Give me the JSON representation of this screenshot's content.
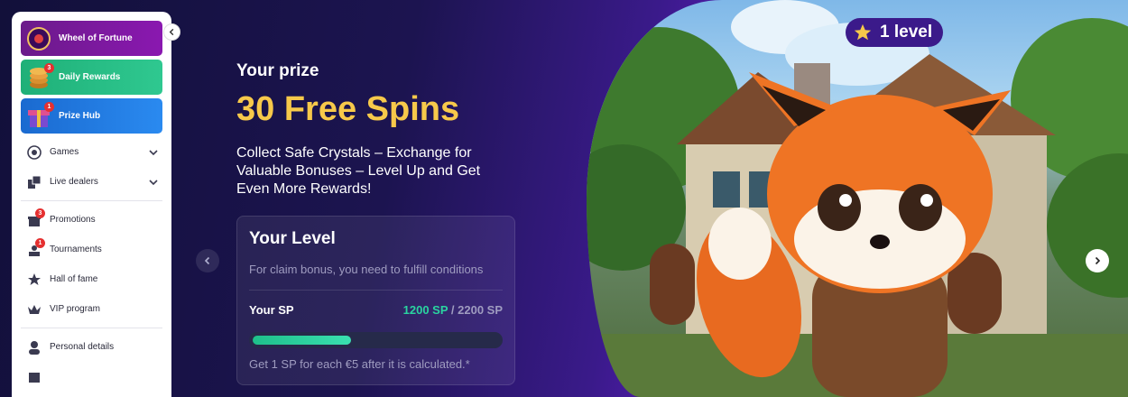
{
  "sidebar": {
    "promos": [
      {
        "label": "Wheel of Fortune",
        "badge": null
      },
      {
        "label": "Daily Rewards",
        "badge": "3"
      },
      {
        "label": "Prize Hub",
        "badge": "1"
      }
    ],
    "nav": [
      {
        "label": "Games"
      },
      {
        "label": "Live dealers"
      }
    ],
    "links": [
      {
        "label": "Promotions",
        "badge": "3"
      },
      {
        "label": "Tournaments",
        "badge": "1"
      },
      {
        "label": "Hall of fame"
      },
      {
        "label": "VIP program"
      }
    ],
    "account": [
      {
        "label": "Personal details"
      }
    ]
  },
  "hero": {
    "prize_label": "Your prize",
    "prize_value": "30 Free Spins",
    "description": "Collect Safe Crystals – Exchange for Valuable Bonuses – Level Up and Get Even More Rewards!",
    "level_badge": "1 level"
  },
  "level_card": {
    "title": "Your Level",
    "hint": "For claim bonus, you need to fulfill conditions",
    "sp_label": "Your SP",
    "sp_current": "1200 SP",
    "sp_separator": " / ",
    "sp_target": "2200 SP",
    "progress": 0.4,
    "note": "Get 1 SP for each €5 after it is calculated.*"
  },
  "colors": {
    "accent_gold": "#f7c94a",
    "accent_green": "#2ad4a0",
    "sidebar_wheel": "#7a18a0",
    "sidebar_daily": "#1fb078",
    "sidebar_hub": "#1a7ae0"
  },
  "icons": {
    "collapse": "chevron-left-icon",
    "prev": "chevron-left-icon",
    "next": "chevron-right-icon",
    "star": "star-icon"
  }
}
